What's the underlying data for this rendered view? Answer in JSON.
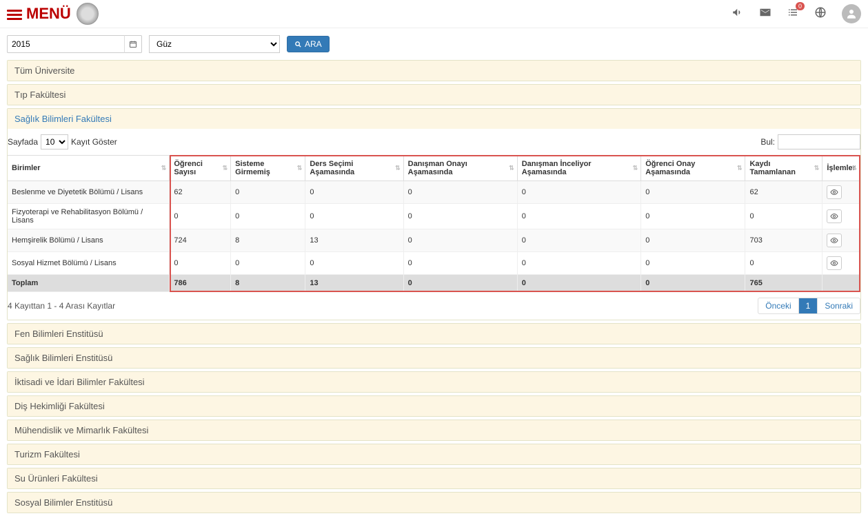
{
  "header": {
    "menu_label": "MENÜ",
    "badge": "0"
  },
  "filters": {
    "year": "2015",
    "semester": "Güz",
    "search_label": "ARA"
  },
  "panels": [
    {
      "label": "Tüm Üniversite"
    },
    {
      "label": "Tıp Fakültesi"
    },
    {
      "label": "Sağlık Bilimleri Fakültesi",
      "active": true
    },
    {
      "label": "Fen Bilimleri Enstitüsü"
    },
    {
      "label": "Sağlık Bilimleri Enstitüsü"
    },
    {
      "label": "İktisadi ve İdari Bilimler Fakültesi"
    },
    {
      "label": "Diş Hekimliği Fakültesi"
    },
    {
      "label": "Mühendislik ve Mimarlık Fakültesi"
    },
    {
      "label": "Turizm Fakültesi"
    },
    {
      "label": "Su Ürünleri Fakültesi"
    },
    {
      "label": "Sosyal Bilimler Enstitüsü"
    }
  ],
  "table": {
    "length_prefix": "Sayfada",
    "length_value": "10",
    "length_suffix": "Kayıt Göster",
    "search_label": "Bul:",
    "info": "4 Kayıttan 1 - 4 Arası Kayıtlar",
    "prev": "Önceki",
    "page": "1",
    "next": "Sonraki",
    "columns": [
      "Birimler",
      "Öğrenci Sayısı",
      "Sisteme Girmemiş",
      "Ders Seçimi Aşamasında",
      "Danışman Onayı Aşamasında",
      "Danışman İnceliyor Aşamasında",
      "Öğrenci Onay Aşamasında",
      "Kaydı Tamamlanan",
      "İşlemler"
    ],
    "rows": [
      {
        "name": "Beslenme ve Diyetetik Bölümü / Lisans",
        "c": [
          "62",
          "0",
          "0",
          "0",
          "0",
          "0",
          "62"
        ]
      },
      {
        "name": "Fizyoterapi ve Rehabilitasyon Bölümü / Lisans",
        "c": [
          "0",
          "0",
          "0",
          "0",
          "0",
          "0",
          "0"
        ]
      },
      {
        "name": "Hemşirelik Bölümü / Lisans",
        "c": [
          "724",
          "8",
          "13",
          "0",
          "0",
          "0",
          "703"
        ]
      },
      {
        "name": "Sosyal Hizmet Bölümü / Lisans",
        "c": [
          "0",
          "0",
          "0",
          "0",
          "0",
          "0",
          "0"
        ]
      }
    ],
    "footer": {
      "label": "Toplam",
      "c": [
        "786",
        "8",
        "13",
        "0",
        "0",
        "0",
        "765"
      ]
    }
  }
}
